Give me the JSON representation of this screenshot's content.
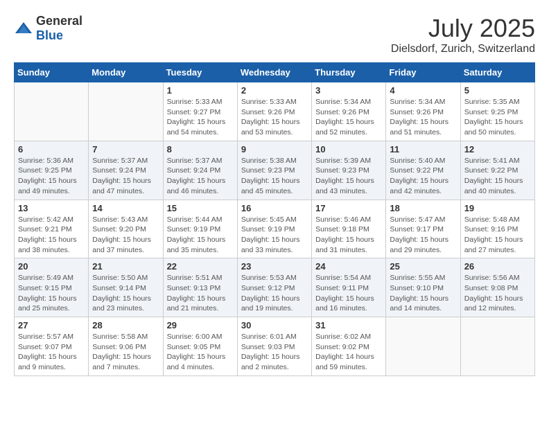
{
  "header": {
    "logo_general": "General",
    "logo_blue": "Blue",
    "month": "July 2025",
    "location": "Dielsdorf, Zurich, Switzerland"
  },
  "weekdays": [
    "Sunday",
    "Monday",
    "Tuesday",
    "Wednesday",
    "Thursday",
    "Friday",
    "Saturday"
  ],
  "weeks": [
    [
      {
        "day": "",
        "info": ""
      },
      {
        "day": "",
        "info": ""
      },
      {
        "day": "1",
        "info": "Sunrise: 5:33 AM\nSunset: 9:27 PM\nDaylight: 15 hours and 54 minutes."
      },
      {
        "day": "2",
        "info": "Sunrise: 5:33 AM\nSunset: 9:26 PM\nDaylight: 15 hours and 53 minutes."
      },
      {
        "day": "3",
        "info": "Sunrise: 5:34 AM\nSunset: 9:26 PM\nDaylight: 15 hours and 52 minutes."
      },
      {
        "day": "4",
        "info": "Sunrise: 5:34 AM\nSunset: 9:26 PM\nDaylight: 15 hours and 51 minutes."
      },
      {
        "day": "5",
        "info": "Sunrise: 5:35 AM\nSunset: 9:25 PM\nDaylight: 15 hours and 50 minutes."
      }
    ],
    [
      {
        "day": "6",
        "info": "Sunrise: 5:36 AM\nSunset: 9:25 PM\nDaylight: 15 hours and 49 minutes."
      },
      {
        "day": "7",
        "info": "Sunrise: 5:37 AM\nSunset: 9:24 PM\nDaylight: 15 hours and 47 minutes."
      },
      {
        "day": "8",
        "info": "Sunrise: 5:37 AM\nSunset: 9:24 PM\nDaylight: 15 hours and 46 minutes."
      },
      {
        "day": "9",
        "info": "Sunrise: 5:38 AM\nSunset: 9:23 PM\nDaylight: 15 hours and 45 minutes."
      },
      {
        "day": "10",
        "info": "Sunrise: 5:39 AM\nSunset: 9:23 PM\nDaylight: 15 hours and 43 minutes."
      },
      {
        "day": "11",
        "info": "Sunrise: 5:40 AM\nSunset: 9:22 PM\nDaylight: 15 hours and 42 minutes."
      },
      {
        "day": "12",
        "info": "Sunrise: 5:41 AM\nSunset: 9:22 PM\nDaylight: 15 hours and 40 minutes."
      }
    ],
    [
      {
        "day": "13",
        "info": "Sunrise: 5:42 AM\nSunset: 9:21 PM\nDaylight: 15 hours and 38 minutes."
      },
      {
        "day": "14",
        "info": "Sunrise: 5:43 AM\nSunset: 9:20 PM\nDaylight: 15 hours and 37 minutes."
      },
      {
        "day": "15",
        "info": "Sunrise: 5:44 AM\nSunset: 9:19 PM\nDaylight: 15 hours and 35 minutes."
      },
      {
        "day": "16",
        "info": "Sunrise: 5:45 AM\nSunset: 9:19 PM\nDaylight: 15 hours and 33 minutes."
      },
      {
        "day": "17",
        "info": "Sunrise: 5:46 AM\nSunset: 9:18 PM\nDaylight: 15 hours and 31 minutes."
      },
      {
        "day": "18",
        "info": "Sunrise: 5:47 AM\nSunset: 9:17 PM\nDaylight: 15 hours and 29 minutes."
      },
      {
        "day": "19",
        "info": "Sunrise: 5:48 AM\nSunset: 9:16 PM\nDaylight: 15 hours and 27 minutes."
      }
    ],
    [
      {
        "day": "20",
        "info": "Sunrise: 5:49 AM\nSunset: 9:15 PM\nDaylight: 15 hours and 25 minutes."
      },
      {
        "day": "21",
        "info": "Sunrise: 5:50 AM\nSunset: 9:14 PM\nDaylight: 15 hours and 23 minutes."
      },
      {
        "day": "22",
        "info": "Sunrise: 5:51 AM\nSunset: 9:13 PM\nDaylight: 15 hours and 21 minutes."
      },
      {
        "day": "23",
        "info": "Sunrise: 5:53 AM\nSunset: 9:12 PM\nDaylight: 15 hours and 19 minutes."
      },
      {
        "day": "24",
        "info": "Sunrise: 5:54 AM\nSunset: 9:11 PM\nDaylight: 15 hours and 16 minutes."
      },
      {
        "day": "25",
        "info": "Sunrise: 5:55 AM\nSunset: 9:10 PM\nDaylight: 15 hours and 14 minutes."
      },
      {
        "day": "26",
        "info": "Sunrise: 5:56 AM\nSunset: 9:08 PM\nDaylight: 15 hours and 12 minutes."
      }
    ],
    [
      {
        "day": "27",
        "info": "Sunrise: 5:57 AM\nSunset: 9:07 PM\nDaylight: 15 hours and 9 minutes."
      },
      {
        "day": "28",
        "info": "Sunrise: 5:58 AM\nSunset: 9:06 PM\nDaylight: 15 hours and 7 minutes."
      },
      {
        "day": "29",
        "info": "Sunrise: 6:00 AM\nSunset: 9:05 PM\nDaylight: 15 hours and 4 minutes."
      },
      {
        "day": "30",
        "info": "Sunrise: 6:01 AM\nSunset: 9:03 PM\nDaylight: 15 hours and 2 minutes."
      },
      {
        "day": "31",
        "info": "Sunrise: 6:02 AM\nSunset: 9:02 PM\nDaylight: 14 hours and 59 minutes."
      },
      {
        "day": "",
        "info": ""
      },
      {
        "day": "",
        "info": ""
      }
    ]
  ]
}
